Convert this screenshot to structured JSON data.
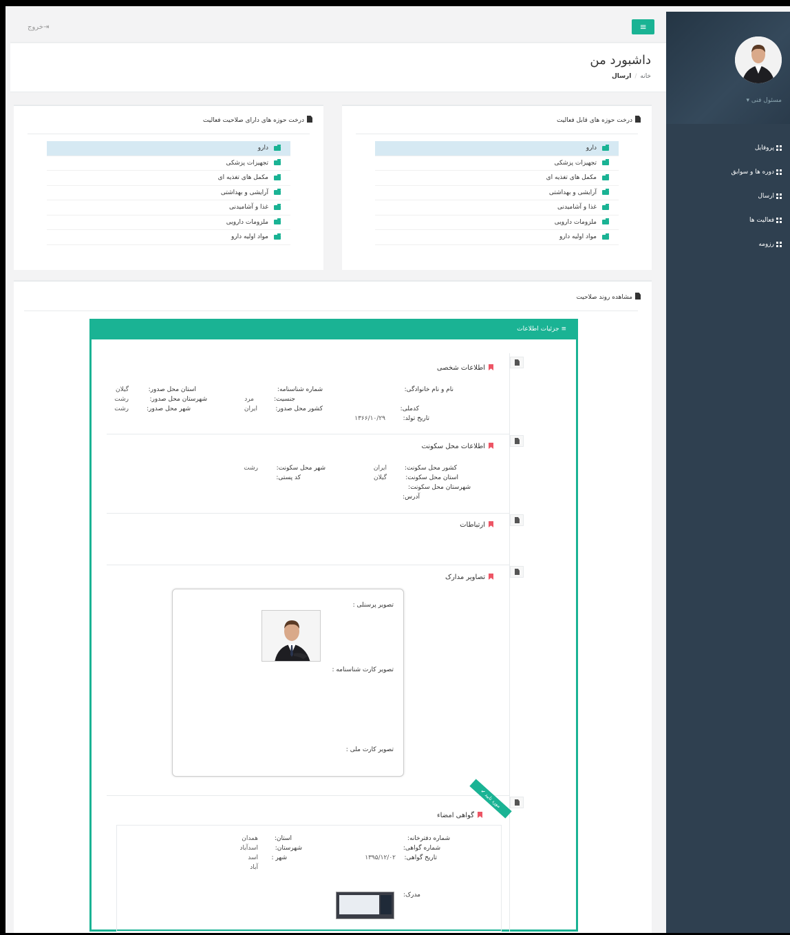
{
  "topbar": {
    "logout_label": "خروج",
    "menu_icon": "hamburger-icon"
  },
  "header": {
    "title": "داشبورد من",
    "breadcrumb_home": "خانه",
    "breadcrumb_current": "ارسال"
  },
  "sidebar": {
    "role": "مسئول فنی ▾",
    "items": [
      {
        "label": "پروفایل"
      },
      {
        "label": "دوره ها و سوابق"
      },
      {
        "label": "ارسال"
      },
      {
        "label": "فعالیت ها"
      },
      {
        "label": "رزومه"
      }
    ]
  },
  "tree_active": {
    "title": "درخت حوزه های قابل فعالیت",
    "items": [
      "دارو",
      "تجهیزات پزشکی",
      "مکمل های تغذیه ای",
      "آرایشی و بهداشتی",
      "غذا و آشامیدنی",
      "ملزومات دارویی",
      "مواد اولیه دارو"
    ]
  },
  "tree_qualified": {
    "title": "درخت حوزه های دارای صلاحیت فعالیت",
    "items": [
      "دارو",
      "تجهیزات پزشکی",
      "مکمل های تغذیه ای",
      "آرایشی و بهداشتی",
      "غذا و آشامیدنی",
      "ملزومات دارویی",
      "مواد اولیه دارو"
    ]
  },
  "process": {
    "title": "مشاهده روند صلاحیت"
  },
  "details": {
    "title": "جزئیات اطلاعات",
    "personal": {
      "title": "اطلاعات شخصی",
      "name_label": "نام و نام خانوادگی:",
      "national_code_label": "کدملی:",
      "birth_date_label": "تاریخ تولد:",
      "birth_date": "۱۳۶۶/۱۰/۲۹",
      "id_number_label": "شماره شناسنامه:",
      "gender_label": "جنسیت:",
      "gender": "مرد",
      "issue_country_label": "کشور محل صدور:",
      "issue_country": "ایران",
      "issue_province_label": "استان محل صدور:",
      "issue_province": "گیلان",
      "issue_county_label": "شهرستان محل صدور:",
      "issue_county": "رشت",
      "issue_city_label": "شهر محل صدور:",
      "issue_city": "رشت"
    },
    "residence": {
      "title": "اطلاعات محل سکونت",
      "country_label": "کشور محل سکونت:",
      "country": "ایران",
      "province_label": "استان محل سکونت:",
      "province": "گیلان",
      "county_label": "شهرستان محل سکونت:",
      "address_label": "آدرس:",
      "city_label": "شهر محل سکونت:",
      "city": "رشت",
      "postal_label": "کد پستی:"
    },
    "contacts": {
      "title": "ارتباطات"
    },
    "documents": {
      "title": "تصاویر مدارک",
      "personal_photo_label": "تصویر پرسنلی :",
      "birth_cert_label": "تصویر کارت شناسنامه :",
      "national_card_label": "تصویر کارت ملی :"
    },
    "signature": {
      "title": "گواهی امضاء",
      "ribbon": "مورد تایید ✔",
      "notary_label": "شماره دفترخانه:",
      "cert_number_label": "شماره گواهی:",
      "cert_date_label": "تاریخ گواهی:",
      "cert_date": "۱۳۹۵/۱۲/۰۲",
      "province_label": "استان:",
      "province": "همدان",
      "county_label": "شهرستان:",
      "county": "اسدآباد",
      "city_label": "شهر :",
      "city_line1": "اسد",
      "city_line2": "آباد",
      "document_label": "مدرک:"
    }
  }
}
